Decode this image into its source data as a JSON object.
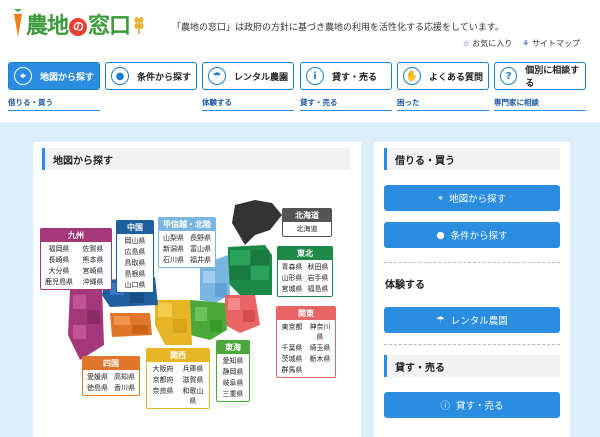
{
  "header": {
    "logo": "農地の窓口",
    "tagline": "「農地の窓口」は政府の方針に基づき農地の利用を活性化する応援をしています。",
    "favorites": "お気に入り",
    "sitemap": "サイトマップ"
  },
  "nav": [
    {
      "label": "地図から探す",
      "icon": "map-pin-icon",
      "sub": "借りる・買う"
    },
    {
      "label": "条件から探す",
      "icon": "apple-icon",
      "sub": ""
    },
    {
      "label": "レンタル農園",
      "icon": "watering-can-icon",
      "sub": "体験する"
    },
    {
      "label": "貸す・売る",
      "icon": "info-icon",
      "sub": "貸す・売る"
    },
    {
      "label": "よくある質問",
      "icon": "handshake-icon",
      "sub": "困った"
    },
    {
      "label": "個別に相談する",
      "icon": "question-icon",
      "sub": "専門家に相談"
    }
  ],
  "map_section": {
    "title": "地図から探す",
    "regions": {
      "kyushu": {
        "name": "九州",
        "prefs": [
          "福岡県",
          "佐賀県",
          "長崎県",
          "熊本県",
          "大分県",
          "宮崎県",
          "鹿児島県",
          "沖縄県"
        ],
        "color": "#a3397b"
      },
      "chugoku": {
        "name": "中国",
        "prefs": [
          "岡山県",
          "広島県",
          "鳥取県",
          "島根県",
          "山口県"
        ],
        "color": "#1e5fa0"
      },
      "koshinetsu": {
        "name": "甲信越・北陸",
        "prefs": [
          "山梨県",
          "長野県",
          "新潟県",
          "富山県",
          "石川県",
          "福井県"
        ],
        "color": "#79b6e0"
      },
      "hokkaido": {
        "name": "北海道",
        "prefs": [
          "北海道"
        ],
        "color": "#555555"
      },
      "tohoku": {
        "name": "東北",
        "prefs": [
          "青森県",
          "秋田県",
          "山形県",
          "岩手県",
          "宮城県",
          "福島県"
        ],
        "color": "#1e8a48"
      },
      "kanto": {
        "name": "関東",
        "prefs": [
          "東京都",
          "神奈川県",
          "千葉県",
          "埼玉県",
          "茨城県",
          "栃木県",
          "群馬県"
        ],
        "color": "#e96565"
      },
      "shikoku": {
        "name": "四国",
        "prefs": [
          "愛媛県",
          "高知県",
          "徳島県",
          "香川県"
        ],
        "color": "#e0762a"
      },
      "kansai": {
        "name": "関西",
        "prefs": [
          "大阪府",
          "兵庫県",
          "京都府",
          "滋賀県",
          "奈良県",
          "和歌山県"
        ],
        "color": "#e6b526"
      },
      "tokai": {
        "name": "東海",
        "prefs": [
          "愛知県",
          "静岡県",
          "岐阜県",
          "三重県"
        ],
        "color": "#4ba83a"
      }
    }
  },
  "side": {
    "borrow_title": "借りる・買う",
    "btn_map": "地図から探す",
    "btn_cond": "条件から探す",
    "experience": "体験する",
    "btn_rental": "レンタル農園",
    "lend_title": "貸す・売る",
    "btn_lend": "貸す・売る"
  },
  "colors": {
    "accent": "#2a8de0",
    "bg": "#dbeefa",
    "logo_green": "#3a9a3a"
  }
}
